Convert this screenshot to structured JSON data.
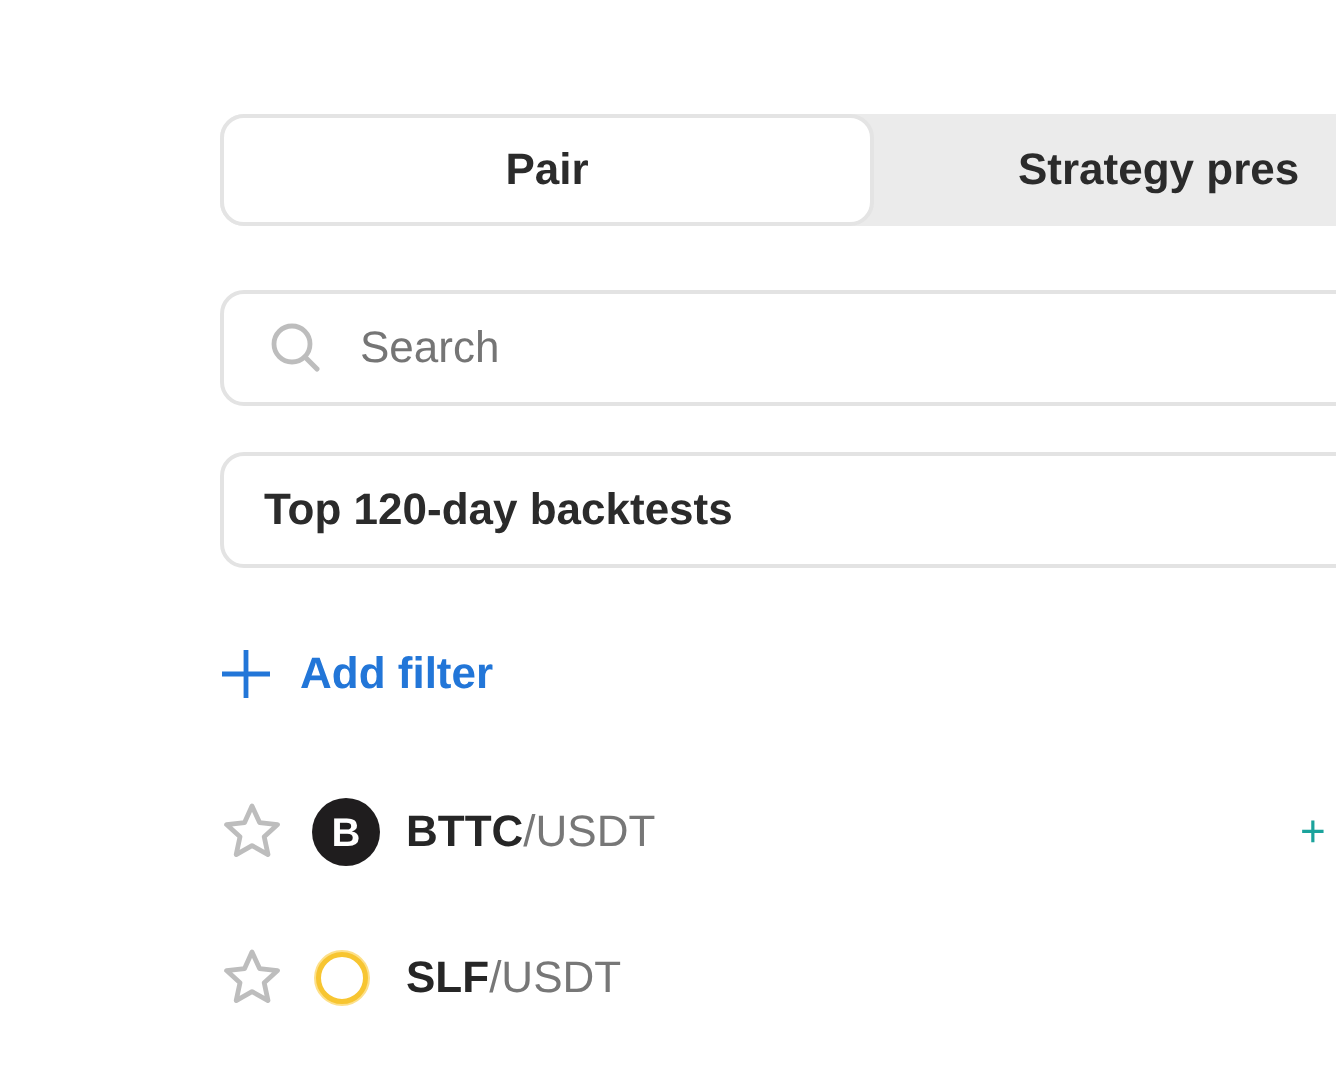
{
  "tabs": [
    {
      "label": "Pair",
      "selected": true
    },
    {
      "label": "Strategy pres",
      "selected": false
    }
  ],
  "search": {
    "placeholder": "Search"
  },
  "preset": {
    "value": "Top 120-day backtests"
  },
  "add_filter": {
    "label": "Add filter"
  },
  "pairs": [
    {
      "name": "**BTTC**/USDT",
      "logo_text": "B",
      "favorite": false,
      "change": "+"
    },
    {
      "name": "**SLF**/USDT",
      "favorite": false
    }
  ]
}
